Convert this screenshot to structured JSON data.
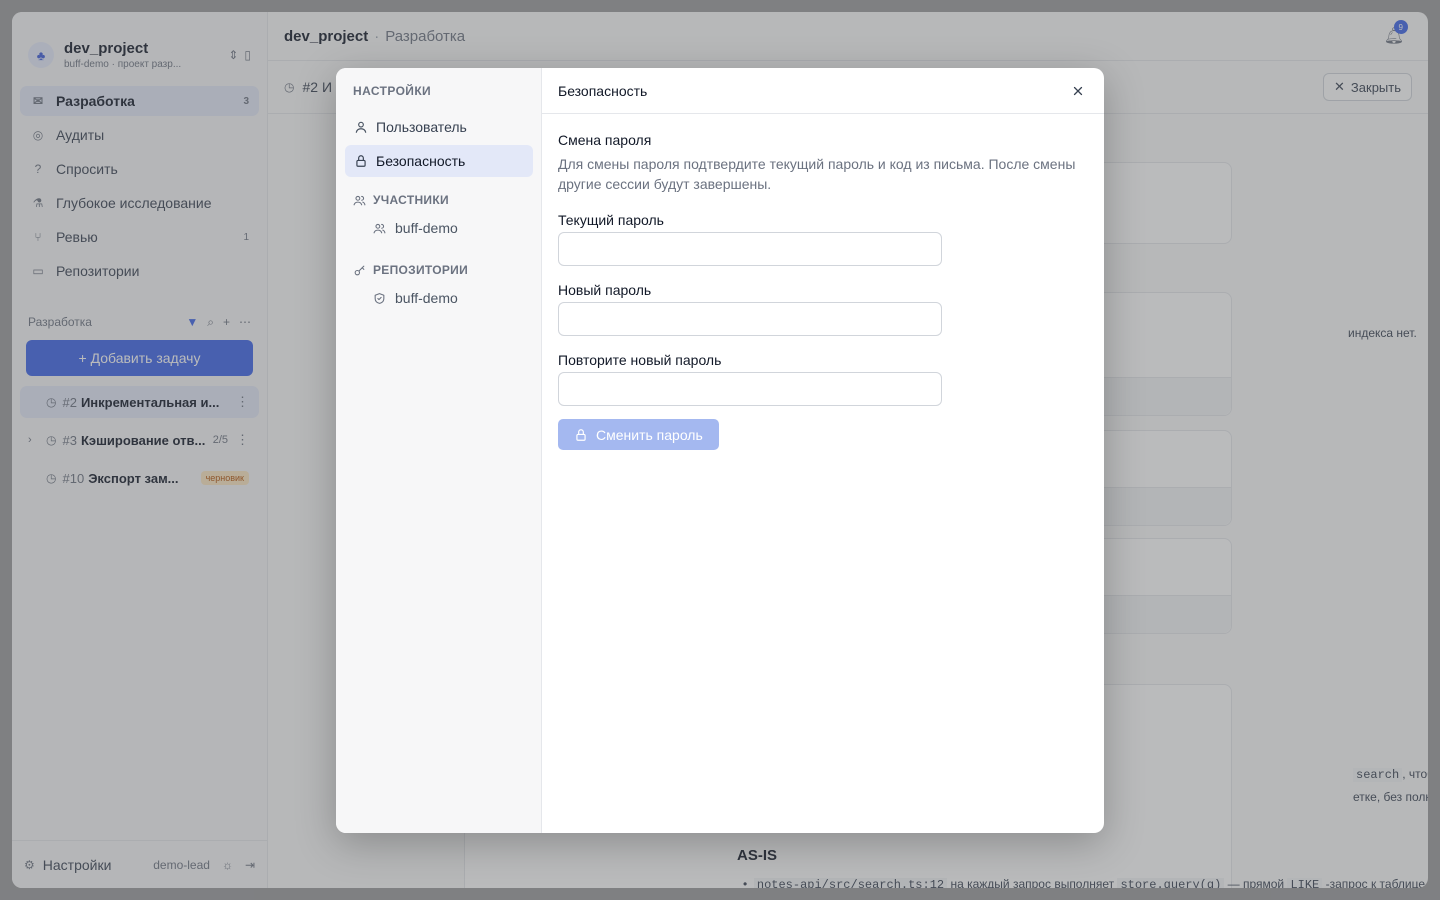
{
  "app": {
    "project": {
      "name": "dev_project",
      "subtitle": "buff-demo · проект разр..."
    },
    "nav": [
      {
        "label": "Разработка",
        "count": "3"
      },
      {
        "label": "Аудиты",
        "count": ""
      },
      {
        "label": "Спросить",
        "count": ""
      },
      {
        "label": "Глубокое исследование",
        "count": ""
      },
      {
        "label": "Ревью",
        "count": "1"
      },
      {
        "label": "Репозитории",
        "count": ""
      }
    ],
    "section_label": "Разработка",
    "add_task_label": "+ Добавить задачу",
    "tasks": [
      {
        "num": "#2",
        "title": "Инкрементальная и...",
        "meta": "",
        "badge": ""
      },
      {
        "num": "#3",
        "title": "Кэширование отв...",
        "meta": "2/5",
        "badge": ""
      },
      {
        "num": "#10",
        "title": "Экспорт зам...",
        "meta": "",
        "badge": "черновик"
      }
    ],
    "footer": {
      "settings": "Настройки",
      "user": "demo-lead"
    },
    "breadcrumb": {
      "project": "dev_project",
      "page": "Разработка"
    },
    "notifications_count": "9",
    "tab_label": "#2 И",
    "close_label": "Закрыть",
    "bg_snippets": {
      "line1": "индекса нет.",
      "line2": "search",
      "line2b": ", чтобы",
      "line3": "етке, без полной",
      "heading": "AS-IS",
      "code1": "notes-api/src/search.ts:12",
      "code_text": " на каждый запрос выполняет ",
      "code2": "store.query(q)",
      "code_text2": " — прямой ",
      "code3": "LIKE",
      "code_text3": " -запрос к таблице"
    }
  },
  "modal": {
    "sidebar_heading": "НАСТРОЙКИ",
    "items": [
      {
        "label": "Пользователь"
      },
      {
        "label": "Безопасность"
      }
    ],
    "groups": [
      {
        "label": "УЧАСТНИКИ",
        "children": [
          "buff-demo"
        ]
      },
      {
        "label": "РЕПОЗИТОРИИ",
        "children": [
          "buff-demo"
        ]
      }
    ],
    "title": "Безопасность",
    "section_title": "Смена пароля",
    "section_desc": "Для смены пароля подтвердите текущий пароль и код из письма. После смены другие сессии будут завершены.",
    "fields": [
      {
        "label": "Текущий пароль",
        "value": "",
        "placeholder": ""
      },
      {
        "label": "Новый пароль",
        "value": "",
        "placeholder": ""
      },
      {
        "label": "Повторите новый пароль",
        "value": "",
        "placeholder": ""
      }
    ],
    "submit_label": "Сменить пароль",
    "colors": {
      "accent": "#3b63e8",
      "button_disabled": "#a4b8f0",
      "active_bg": "#e3e8f8"
    }
  }
}
